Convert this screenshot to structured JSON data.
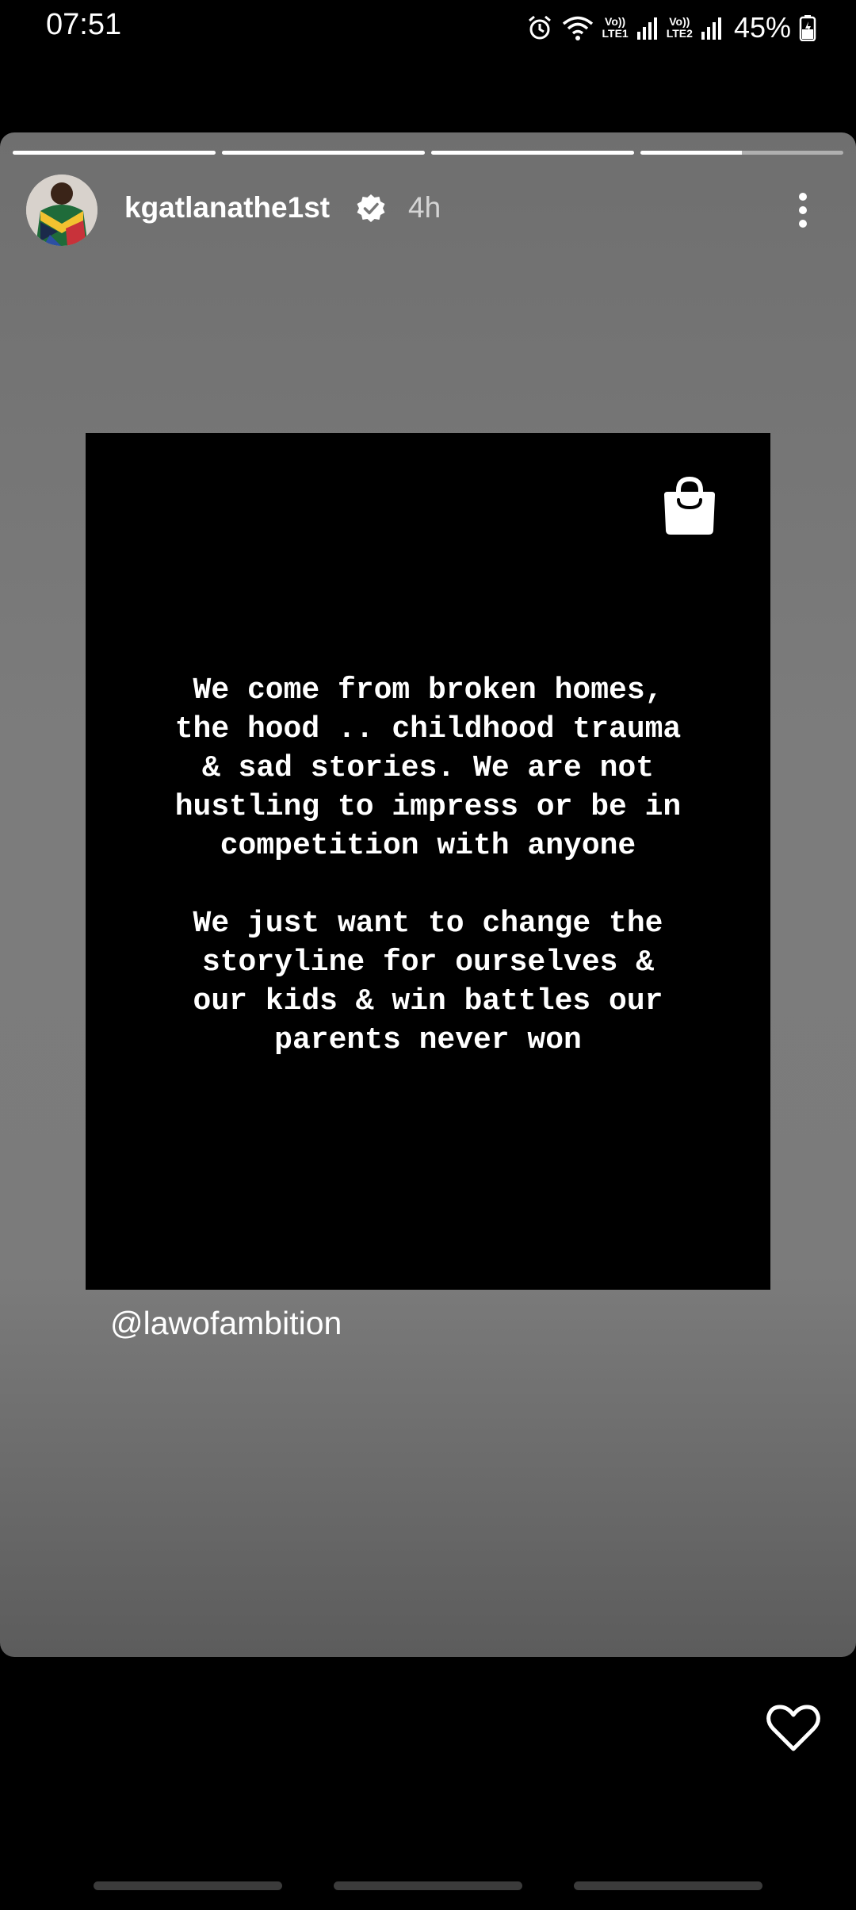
{
  "status_bar": {
    "time": "07:51",
    "sim1_top": "Vo))",
    "sim1_bottom": "LTE1",
    "sim2_top": "Vo))",
    "sim2_bottom": "LTE2",
    "battery": "45%",
    "icons": [
      "alarm-icon",
      "wifi-icon",
      "signal-icon",
      "battery-icon"
    ]
  },
  "story": {
    "progress": [
      1,
      1,
      1,
      0.5
    ],
    "username": "kgatlanathe1st",
    "verified": true,
    "time_ago": "4h",
    "quote": "We come from broken homes,\nthe hood .. childhood trauma\n& sad stories. We are not\nhustling to impress or be in\ncompetition with anyone\n\nWe just want to change the\nstoryline for ourselves &\nour kids & win battles our\nparents never won",
    "mention": "@lawofambition"
  },
  "colors": {
    "background": "#000000",
    "card_gray": "#7a7a7a",
    "text": "#ffffff"
  }
}
